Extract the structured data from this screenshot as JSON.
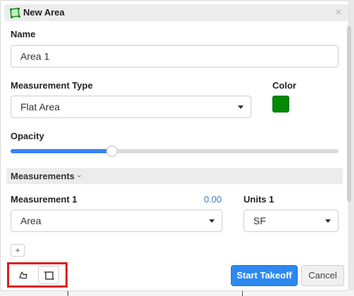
{
  "dialog": {
    "title": "New Area",
    "title_icon": "area-polygon-icon",
    "close_glyph": "×",
    "accent_color": "#2d89ef"
  },
  "name_field": {
    "label": "Name",
    "value": "Area 1"
  },
  "measurement_type": {
    "label": "Measurement Type",
    "value": "Flat Area"
  },
  "color": {
    "label": "Color",
    "value": "#008a00"
  },
  "opacity": {
    "label": "Opacity",
    "value_percent": 31
  },
  "measurements_section": {
    "label": "Measurements",
    "chevron": "⌄",
    "items": [
      {
        "label": "Measurement 1",
        "value": "0.00",
        "type_value": "Area",
        "units_label": "Units 1",
        "units_value": "SF"
      }
    ],
    "add_glyph": "+"
  },
  "footer": {
    "tools": [
      {
        "name": "polygon-tool",
        "icon": "polygon-icon",
        "active": false
      },
      {
        "name": "rectangle-tool",
        "icon": "rectangle-icon",
        "active": true
      }
    ],
    "start_label": "Start Takeoff",
    "cancel_label": "Cancel"
  }
}
